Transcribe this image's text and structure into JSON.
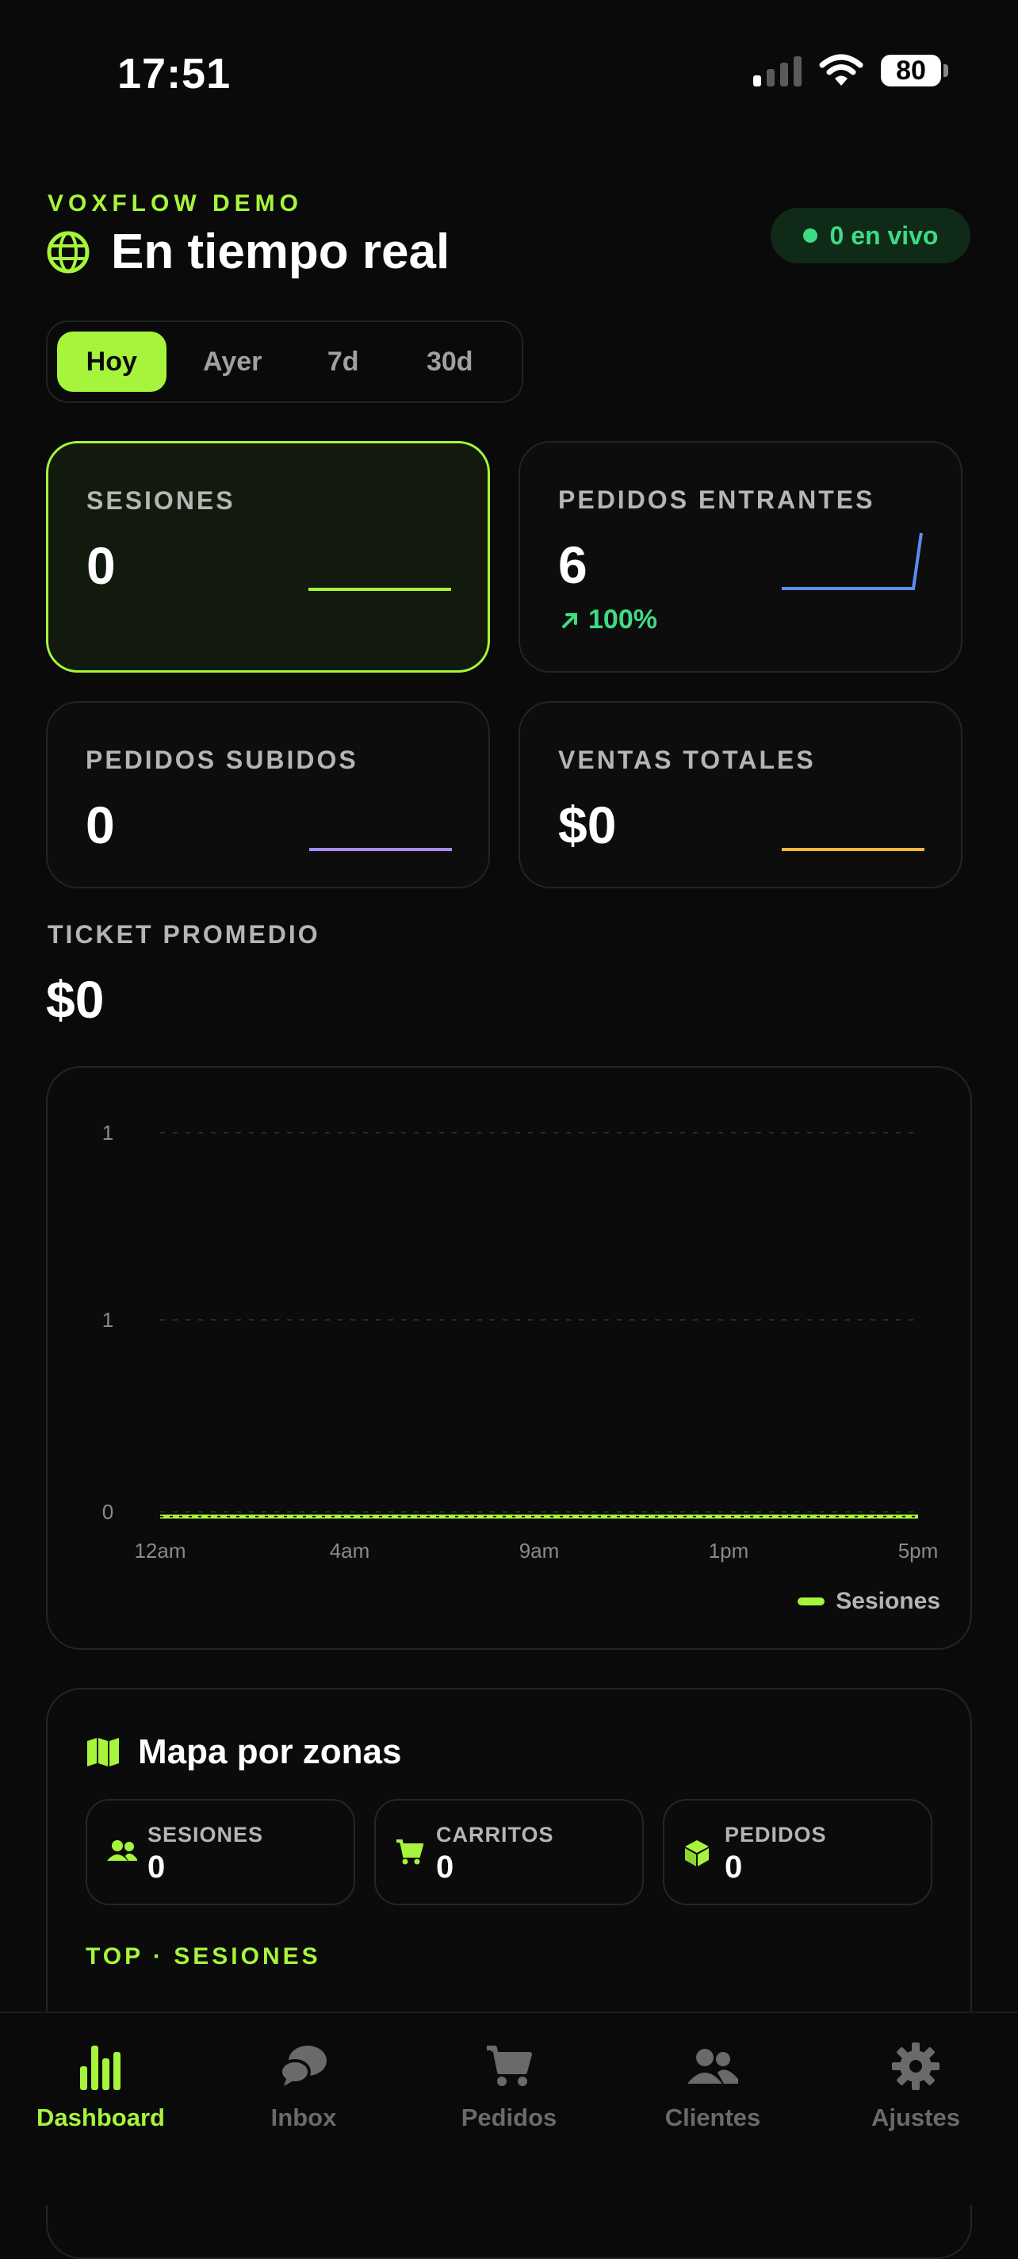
{
  "status_bar": {
    "time": "17:51",
    "battery": "80"
  },
  "header": {
    "brand": "VOXFLOW DEMO",
    "title": "En tiempo real",
    "live_label": "0 en vivo"
  },
  "range_tabs": [
    {
      "label": "Hoy",
      "active": true
    },
    {
      "label": "Ayer",
      "active": false
    },
    {
      "label": "7d",
      "active": false
    },
    {
      "label": "30d",
      "active": false
    }
  ],
  "metrics": [
    {
      "label": "SESIONES",
      "value": "0",
      "color": "#a6f53c",
      "active": true
    },
    {
      "label": "PEDIDOS ENTRANTES",
      "value": "6",
      "delta": "100%",
      "color": "#5b8def"
    },
    {
      "label": "PEDIDOS SUBIDOS",
      "value": "0",
      "color": "#a78bfa"
    },
    {
      "label": "VENTAS TOTALES",
      "value": "$0",
      "color": "#f5b73c"
    }
  ],
  "ticket": {
    "label": "TICKET PROMEDIO",
    "value": "$0"
  },
  "chart_data": {
    "type": "line",
    "x": [
      "12am",
      "4am",
      "9am",
      "1pm",
      "5pm"
    ],
    "y_ticks": [
      "1",
      "1",
      "0"
    ],
    "series": [
      {
        "name": "Sesiones",
        "values": [
          0,
          0,
          0,
          0,
          0
        ],
        "color": "#a6f53c"
      }
    ],
    "ylim": [
      0,
      1
    ],
    "grid": true,
    "legend_position": "bottom-right"
  },
  "map": {
    "title": "Mapa por zonas",
    "stats": [
      {
        "label": "SESIONES",
        "value": "0",
        "icon": "users-icon"
      },
      {
        "label": "CARRITOS",
        "value": "0",
        "icon": "cart-icon"
      },
      {
        "label": "PEDIDOS",
        "value": "0",
        "icon": "box-icon"
      }
    ],
    "top_label": "TOP · SESIONES"
  },
  "tabbar": [
    {
      "label": "Dashboard",
      "icon": "bar-chart-icon",
      "active": true
    },
    {
      "label": "Inbox",
      "icon": "chat-icon",
      "active": false
    },
    {
      "label": "Pedidos",
      "icon": "cart-icon",
      "active": false
    },
    {
      "label": "Clientes",
      "icon": "users-icon",
      "active": false
    },
    {
      "label": "Ajustes",
      "icon": "gear-icon",
      "active": false
    }
  ]
}
